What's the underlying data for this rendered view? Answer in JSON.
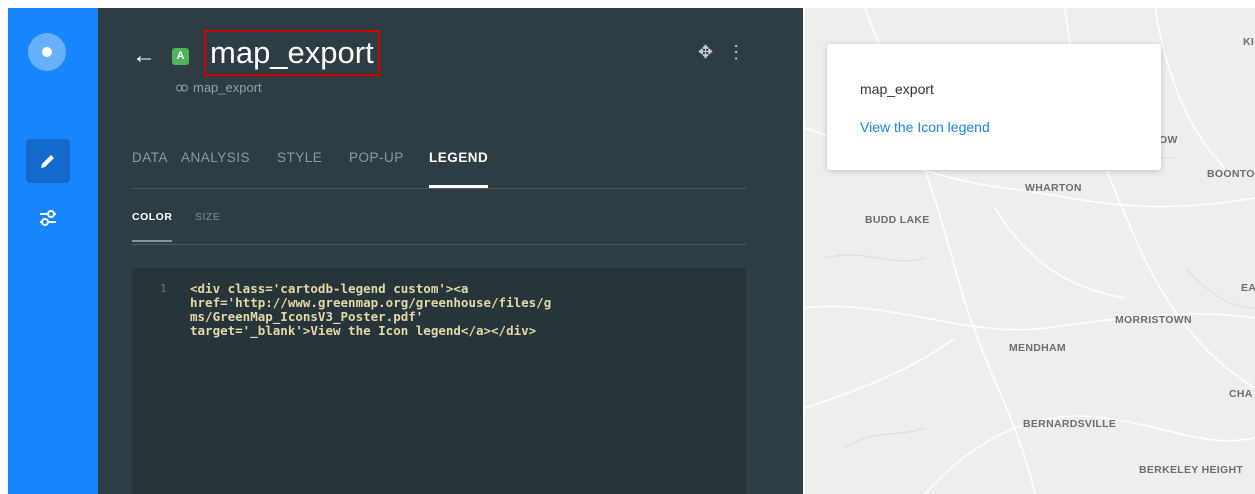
{
  "header": {
    "back_glyph": "←",
    "layer_badge": "A",
    "title": "map_export",
    "subtitle": "map_export"
  },
  "tabs": [
    {
      "label": "DATA"
    },
    {
      "label": "ANALYSIS"
    },
    {
      "label": "STYLE"
    },
    {
      "label": "POP-UP"
    },
    {
      "label": "LEGEND",
      "active": true
    }
  ],
  "subtabs": [
    {
      "label": "COLOR",
      "active": true
    },
    {
      "label": "SIZE"
    }
  ],
  "editor": {
    "line_number": "1",
    "code_line1": "<div class='cartodb-legend custom'><a",
    "code_line2": "href='http://www.greenmap.org/greenhouse/files/g",
    "code_line3": "ms/GreenMap_IconsV3_Poster.pdf'",
    "code_line4": "target='_blank'>View the Icon legend</a></div>"
  },
  "legend": {
    "title": "map_export",
    "link_text": "View the Icon legend"
  },
  "map_labels": {
    "ow": "OW",
    "boonton": "BOONTO",
    "wharton": "WHARTON",
    "budd_lake": "BUDD LAKE",
    "east": "EAS",
    "morristown": "MORRISTOWN",
    "mendham": "MENDHAM",
    "cha": "CHA",
    "bernardsville": "BERNARDSVILLE",
    "berkeley": "BERKELEY HEIGHT",
    "ki": "KI"
  },
  "colors": {
    "rail": "#1785fb",
    "panel": "#2e3c43",
    "highlight_box": "#d00000",
    "link": "#1785fb"
  }
}
